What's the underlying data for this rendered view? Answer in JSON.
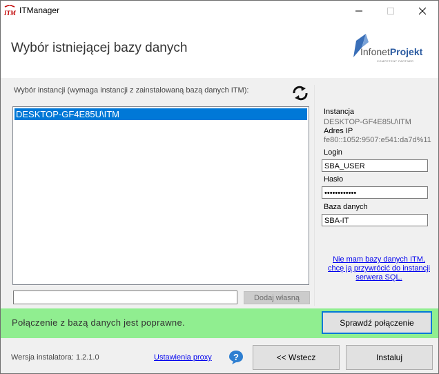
{
  "window": {
    "title": "ITManager"
  },
  "header": {
    "title": "Wybór istniejącej bazy danych",
    "logo": {
      "text_light": "Infonet",
      "text_bold": "Projekt",
      "subtitle": "COMPETENT PARTNER"
    }
  },
  "instances": {
    "label": "Wybór instancji (wymaga instancji z zainstalowaną bazą danych ITM):",
    "items": [
      "DESKTOP-GF4E85U\\ITM"
    ],
    "selected": "DESKTOP-GF4E85U\\ITM",
    "custom_value": "",
    "add_button": "Dodaj własną"
  },
  "details": {
    "instance_label": "Instancja",
    "instance_value": "DESKTOP-GF4E85U\\ITM",
    "address_label": "Adres IP",
    "address_value": "fe80::1052:9507:e541:da7d%11",
    "login_label": "Login",
    "login_value": "SBA_USER",
    "password_label": "Hasło",
    "password_value": "••••••••••••",
    "db_label": "Baza danych",
    "db_value": "SBA-IT",
    "restore_link": "Nie mam bazy danych ITM, chcę ją przywrócić do instancji serwera SQL."
  },
  "status": {
    "message": "Połączenie z bazą danych jest poprawne.",
    "check_button": "Sprawdź połączenie",
    "color": "#90ee90"
  },
  "footer": {
    "version": "Wersja instalatora: 1.2.1.0",
    "proxy_link": "Ustawienia proxy",
    "back_button": "<< Wstecz",
    "install_button": "Instaluj"
  }
}
